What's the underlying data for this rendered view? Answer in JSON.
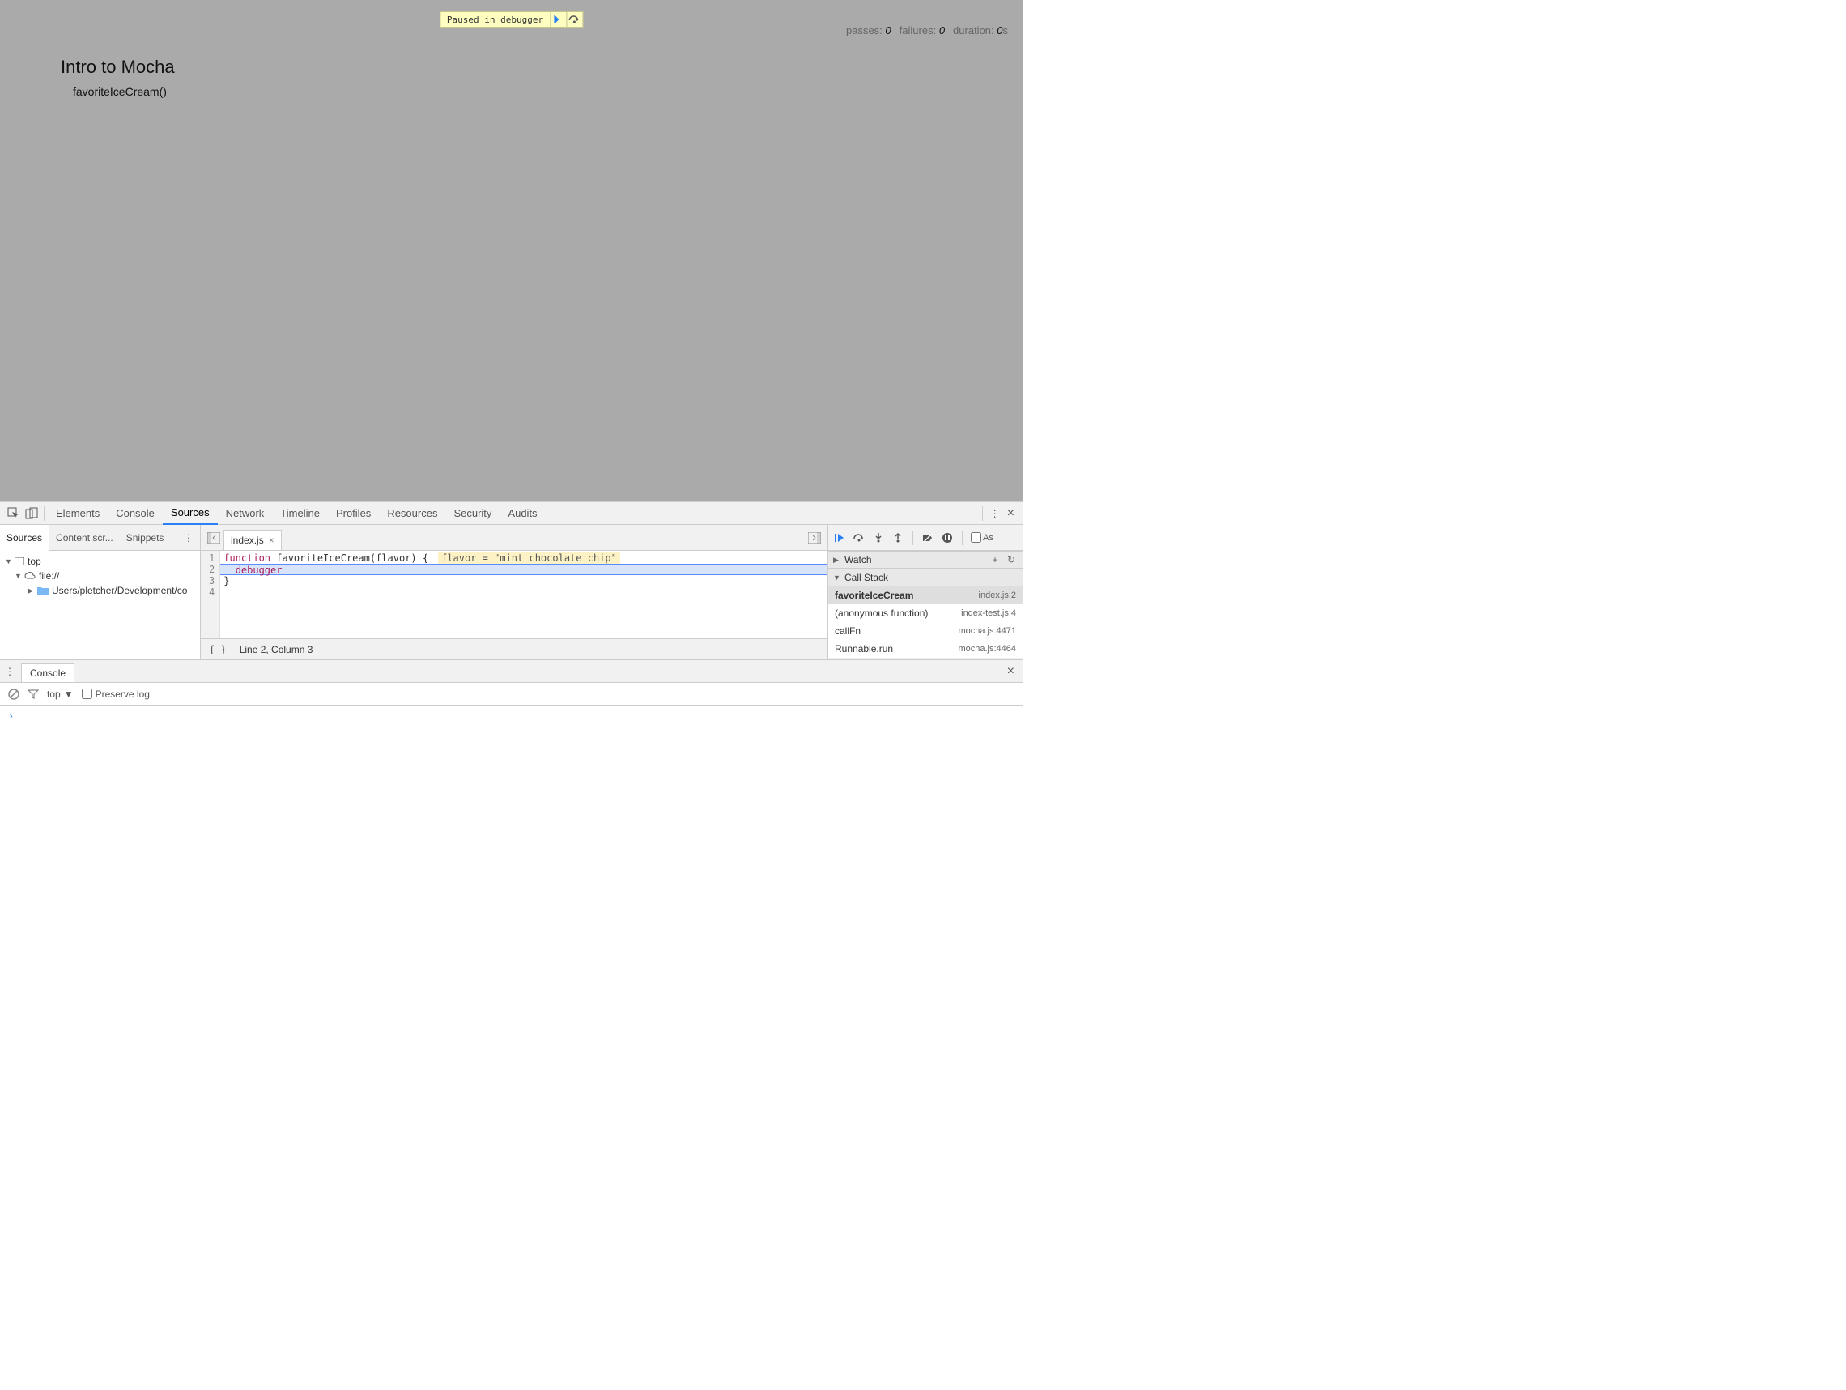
{
  "overlay": {
    "message": "Paused in debugger"
  },
  "mocha": {
    "title": "Intro to Mocha",
    "subtitle": "favoriteIceCream()",
    "stats": {
      "passes_label": "passes:",
      "passes": "0",
      "failures_label": "failures:",
      "failures": "0",
      "duration_label": "duration:",
      "duration": "0",
      "duration_unit": "s"
    }
  },
  "devtools": {
    "tabs": [
      "Elements",
      "Console",
      "Sources",
      "Network",
      "Timeline",
      "Profiles",
      "Resources",
      "Security",
      "Audits"
    ],
    "active_tab": "Sources",
    "left_tabs": [
      "Sources",
      "Content scr...",
      "Snippets"
    ],
    "tree": {
      "root": "top",
      "origin": "file://",
      "folder": "Users/pletcher/Development/co"
    },
    "filetab": "index.js",
    "code": {
      "line1_kw": "function",
      "line1_rest": " favoriteIceCream(flavor) {",
      "line1_inline": "flavor = \"mint chocolate chip\"",
      "line2_indent": "  ",
      "line2_kw": "debugger",
      "line3": "}",
      "line_numbers": [
        "1",
        "2",
        "3",
        "4"
      ]
    },
    "status": "Line 2, Column 3",
    "watch_label": "Watch",
    "callstack_label": "Call Stack",
    "stack": [
      {
        "name": "favoriteIceCream",
        "loc": "index.js:2"
      },
      {
        "name": "(anonymous function)",
        "loc": "index-test.js:4"
      },
      {
        "name": "callFn",
        "loc": "mocha.js:4471"
      },
      {
        "name": "Runnable.run",
        "loc": "mocha.js:4464"
      }
    ],
    "async_label": "As"
  },
  "drawer": {
    "tab": "Console",
    "context": "top",
    "preserve_label": "Preserve log",
    "prompt": "›"
  }
}
